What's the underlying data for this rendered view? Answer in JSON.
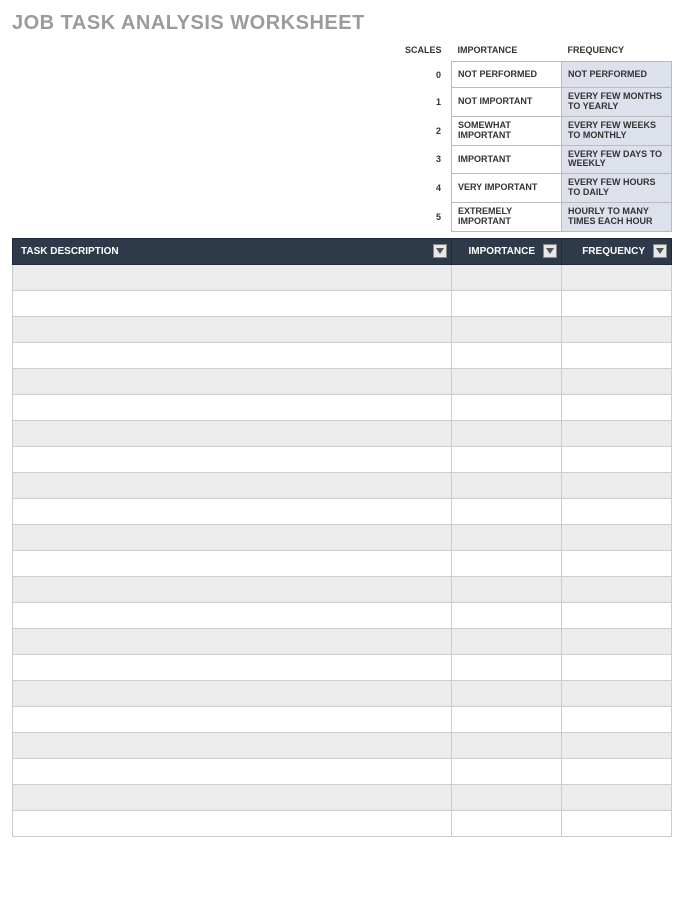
{
  "title": "JOB TASK ANALYSIS WORKSHEET",
  "scales": {
    "header": {
      "scales": "SCALES",
      "importance": "IMPORTANCE",
      "frequency": "FREQUENCY"
    },
    "rows": [
      {
        "num": "0",
        "importance": "NOT PERFORMED",
        "frequency": "NOT PERFORMED"
      },
      {
        "num": "1",
        "importance": "NOT IMPORTANT",
        "frequency": "EVERY FEW MONTHS TO YEARLY"
      },
      {
        "num": "2",
        "importance": "SOMEWHAT IMPORTANT",
        "frequency": "EVERY FEW WEEKS TO MONTHLY"
      },
      {
        "num": "3",
        "importance": "IMPORTANT",
        "frequency": "EVERY FEW DAYS TO WEEKLY"
      },
      {
        "num": "4",
        "importance": "VERY IMPORTANT",
        "frequency": "EVERY FEW HOURS TO DAILY"
      },
      {
        "num": "5",
        "importance": "EXTREMELY IMPORTANT",
        "frequency": "HOURLY TO MANY TIMES EACH HOUR"
      }
    ]
  },
  "table": {
    "headers": {
      "task": "TASK DESCRIPTION",
      "importance": "IMPORTANCE",
      "frequency": "FREQUENCY"
    },
    "rows": [
      {
        "task": "",
        "importance": "",
        "frequency": ""
      },
      {
        "task": "",
        "importance": "",
        "frequency": ""
      },
      {
        "task": "",
        "importance": "",
        "frequency": ""
      },
      {
        "task": "",
        "importance": "",
        "frequency": ""
      },
      {
        "task": "",
        "importance": "",
        "frequency": ""
      },
      {
        "task": "",
        "importance": "",
        "frequency": ""
      },
      {
        "task": "",
        "importance": "",
        "frequency": ""
      },
      {
        "task": "",
        "importance": "",
        "frequency": ""
      },
      {
        "task": "",
        "importance": "",
        "frequency": ""
      },
      {
        "task": "",
        "importance": "",
        "frequency": ""
      },
      {
        "task": "",
        "importance": "",
        "frequency": ""
      },
      {
        "task": "",
        "importance": "",
        "frequency": ""
      },
      {
        "task": "",
        "importance": "",
        "frequency": ""
      },
      {
        "task": "",
        "importance": "",
        "frequency": ""
      },
      {
        "task": "",
        "importance": "",
        "frequency": ""
      },
      {
        "task": "",
        "importance": "",
        "frequency": ""
      },
      {
        "task": "",
        "importance": "",
        "frequency": ""
      },
      {
        "task": "",
        "importance": "",
        "frequency": ""
      },
      {
        "task": "",
        "importance": "",
        "frequency": ""
      },
      {
        "task": "",
        "importance": "",
        "frequency": ""
      },
      {
        "task": "",
        "importance": "",
        "frequency": ""
      },
      {
        "task": "",
        "importance": "",
        "frequency": ""
      }
    ]
  }
}
